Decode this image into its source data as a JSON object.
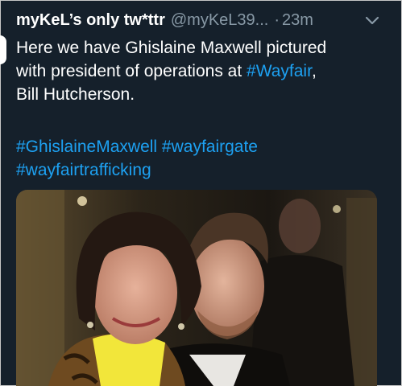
{
  "tweet": {
    "display_name": "myKeL’s only tw*ttr",
    "handle": "@myKeL39...",
    "separator": "·",
    "time": "23m",
    "text": {
      "line1": "Here we have Ghislaine Maxwell pictured",
      "line2_prefix": "with president of operations at ",
      "line2_hashtag": "#Wayfair",
      "line2_suffix": ",",
      "line3": "Bill Hutcherson."
    },
    "hashtags": {
      "line1_a": "#GhislaineMaxwell",
      "line1_b": "#wayfairgate",
      "line2": "#wayfairtrafficking"
    }
  },
  "icons": {
    "menu": "chevron-down-icon"
  },
  "colors": {
    "background": "#15202b",
    "text": "#ffffff",
    "secondary": "#8899a6",
    "link": "#1da1f2"
  }
}
